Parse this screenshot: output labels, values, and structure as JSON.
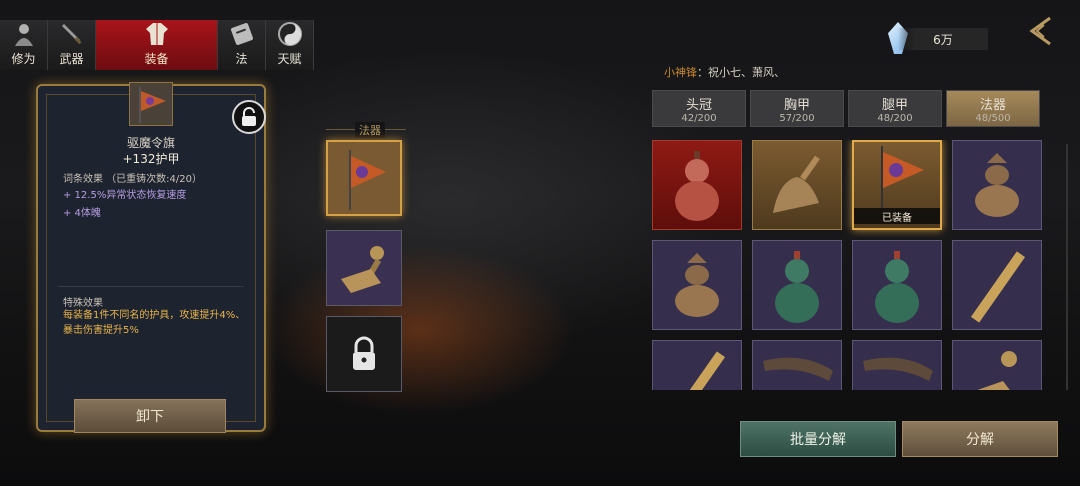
{
  "tabs": [
    {
      "label": "修为",
      "icon": "cultivator-icon"
    },
    {
      "label": "武器",
      "icon": "sword-icon"
    },
    {
      "label": "装备",
      "icon": "robe-icon",
      "active": true
    },
    {
      "label": "法",
      "icon": "scroll-icon"
    },
    {
      "label": "天赋",
      "icon": "yin-yang-icon"
    }
  ],
  "currency": {
    "amount": "6万",
    "icon": "spirit-crystal-icon"
  },
  "detail": {
    "name": "驱魔令旗",
    "stat_prefix": "+132",
    "stat_name": "护甲",
    "affix_title": "词条效果 （已重铸次数:4/20）",
    "affixes": [
      "+ 12.5%异常状态恢复速度",
      "+ 4体魄"
    ],
    "special_title": "特殊效果",
    "special_text": "每装备1件不同名的护具，攻速提升4%、暴击伤害提升5%",
    "unequip_label": "卸下"
  },
  "mid": {
    "label": "法器"
  },
  "set": {
    "name": "小神锋",
    "members": "：祝小七、萧风、"
  },
  "categories": [
    {
      "name": "头冠",
      "count": "42/200"
    },
    {
      "name": "胸甲",
      "count": "57/200"
    },
    {
      "name": "腿甲",
      "count": "48/200"
    },
    {
      "name": "法器",
      "count": "48/500",
      "active": true
    }
  ],
  "grid": [
    {
      "icon": "gourd-red-icon",
      "bg": "red"
    },
    {
      "icon": "bell-icon",
      "bg": "gold"
    },
    {
      "icon": "demon-flag-icon",
      "bg": "gold",
      "selected": true,
      "tag": "已装备"
    },
    {
      "icon": "incense-burner-icon",
      "bg": "purple"
    },
    {
      "icon": "incense-burner-icon",
      "bg": "purple"
    },
    {
      "icon": "gourd-jade-icon",
      "bg": "purple"
    },
    {
      "icon": "gourd-jade-icon",
      "bg": "purple"
    },
    {
      "icon": "ruler-icon",
      "bg": "purple"
    },
    {
      "icon": "ruler-icon",
      "bg": "purple"
    },
    {
      "icon": "horn-icon",
      "bg": "purple"
    },
    {
      "icon": "horn-icon",
      "bg": "purple"
    },
    {
      "icon": "seal-stamp-icon",
      "bg": "purple"
    }
  ],
  "buttons": {
    "batch": "批量分解",
    "decompose": "分解"
  },
  "colors": {
    "accent_red": "#a8141a",
    "gold": "#d6a045",
    "purple_cell": "#352e4c",
    "affix": "#b59ce0",
    "special": "#e8b54a"
  }
}
